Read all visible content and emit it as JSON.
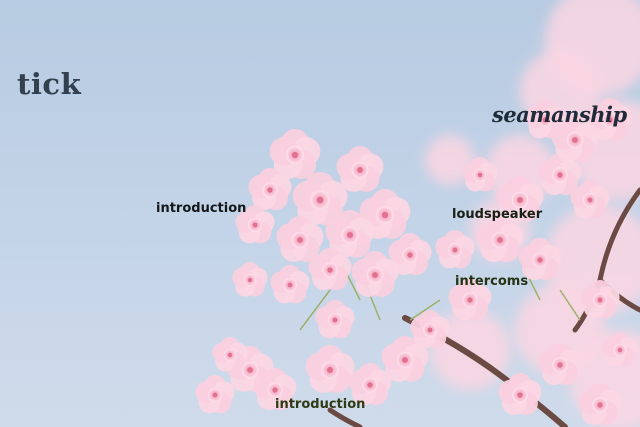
{
  "image": {
    "subject": "pink cherry blossoms on a branch against a pale blue sky",
    "colors": {
      "sky": "#c0d1e6",
      "petal_light": "#fbd6e3",
      "petal_mid": "#f4a9c3",
      "petal_center": "#e2708f",
      "branch": "#6a4a42"
    }
  },
  "overlay_words": {
    "tick": "tick",
    "seamanship": "seamanship",
    "introduction_upper": "introduction",
    "loudspeaker": "loudspeaker",
    "intercoms": "intercoms",
    "introduction_lower": "introduction"
  }
}
